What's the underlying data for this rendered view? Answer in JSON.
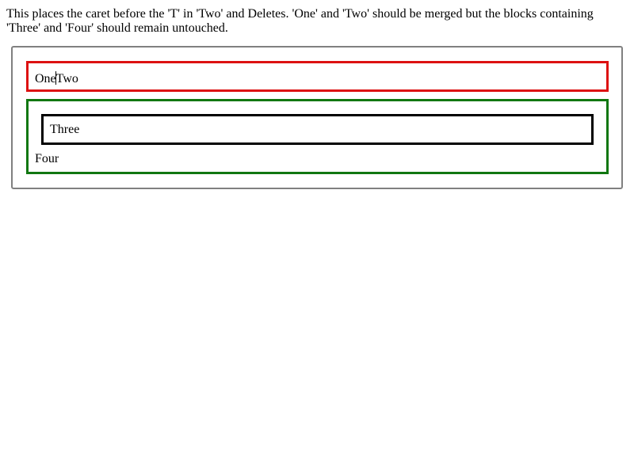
{
  "description": "This places the caret before the 'T' in 'Two' and Deletes. 'One' and 'Two' should be merged but the blocks containing 'Three' and 'Four' should remain untouched.",
  "editor": {
    "merged_block": {
      "text_before_caret": "One",
      "text_after_caret": "Two",
      "border_color": "#dd1111"
    },
    "outer_block": {
      "border_color": "#117711",
      "inner_block": {
        "text": "Three",
        "border_color": "#000000"
      },
      "text": "Four"
    },
    "frame_color": "#808080"
  }
}
